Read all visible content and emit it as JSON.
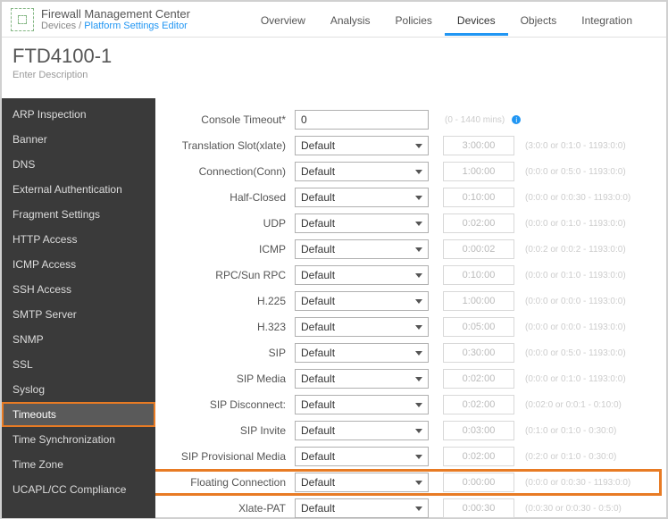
{
  "header": {
    "app_title": "Firewall Management Center",
    "breadcrumb_prefix": "Devices / ",
    "breadcrumb_link": "Platform Settings Editor",
    "nav": [
      "Overview",
      "Analysis",
      "Policies",
      "Devices",
      "Objects",
      "Integration"
    ],
    "nav_active": "Devices"
  },
  "subheader": {
    "title": "FTD4100-1",
    "desc": "Enter Description"
  },
  "sidebar": {
    "items": [
      "ARP Inspection",
      "Banner",
      "DNS",
      "External Authentication",
      "Fragment Settings",
      "HTTP Access",
      "ICMP Access",
      "SSH Access",
      "SMTP Server",
      "SNMP",
      "SSL",
      "Syslog",
      "Timeouts",
      "Time Synchronization",
      "Time Zone",
      "UCAPL/CC Compliance"
    ],
    "selected": "Timeouts"
  },
  "rows": [
    {
      "label": "Console Timeout*",
      "type": "input",
      "value": "0",
      "hint": "(0 - 1440 mins)",
      "info": true
    },
    {
      "label": "Translation Slot(xlate)",
      "type": "select",
      "value": "Default",
      "box": "3:00:00",
      "range": "(3:0:0 or 0:1:0 - 1193:0:0)"
    },
    {
      "label": "Connection(Conn)",
      "type": "select",
      "value": "Default",
      "box": "1:00:00",
      "range": "(0:0:0 or 0:5:0 - 1193:0:0)"
    },
    {
      "label": "Half-Closed",
      "type": "select",
      "value": "Default",
      "box": "0:10:00",
      "range": "(0:0:0 or 0:0:30 - 1193:0:0)"
    },
    {
      "label": "UDP",
      "type": "select",
      "value": "Default",
      "box": "0:02:00",
      "range": "(0:0:0 or 0:1:0 - 1193:0:0)"
    },
    {
      "label": "ICMP",
      "type": "select",
      "value": "Default",
      "box": "0:00:02",
      "range": "(0:0:2 or 0:0:2 - 1193:0:0)"
    },
    {
      "label": "RPC/Sun RPC",
      "type": "select",
      "value": "Default",
      "box": "0:10:00",
      "range": "(0:0:0 or 0:1:0 - 1193:0:0)"
    },
    {
      "label": "H.225",
      "type": "select",
      "value": "Default",
      "box": "1:00:00",
      "range": "(0:0:0 or 0:0:0 - 1193:0:0)"
    },
    {
      "label": "H.323",
      "type": "select",
      "value": "Default",
      "box": "0:05:00",
      "range": "(0:0:0 or 0:0:0 - 1193:0:0)"
    },
    {
      "label": "SIP",
      "type": "select",
      "value": "Default",
      "box": "0:30:00",
      "range": "(0:0:0 or 0:5:0 - 1193:0:0)"
    },
    {
      "label": "SIP Media",
      "type": "select",
      "value": "Default",
      "box": "0:02:00",
      "range": "(0:0:0 or 0:1:0 - 1193:0:0)"
    },
    {
      "label": "SIP Disconnect:",
      "type": "select",
      "value": "Default",
      "box": "0:02:00",
      "range": "(0:02:0 or 0:0:1 - 0:10:0)"
    },
    {
      "label": "SIP Invite",
      "type": "select",
      "value": "Default",
      "box": "0:03:00",
      "range": "(0:1:0 or 0:1:0 - 0:30:0)"
    },
    {
      "label": "SIP Provisional Media",
      "type": "select",
      "value": "Default",
      "box": "0:02:00",
      "range": "(0:2:0 or 0:1:0 - 0:30:0)"
    },
    {
      "label": "Floating Connection",
      "type": "select",
      "value": "Default",
      "box": "0:00:00",
      "range": "(0:0:0 or 0:0:30 - 1193:0:0)",
      "highlight": true
    },
    {
      "label": "Xlate-PAT",
      "type": "select",
      "value": "Default",
      "box": "0:00:30",
      "range": "(0:0:30 or 0:0:30 - 0:5:0)"
    }
  ]
}
